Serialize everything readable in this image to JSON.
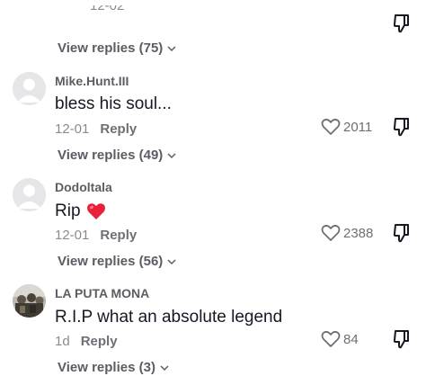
{
  "top": {
    "partial_timestamp": "12-02",
    "view_replies": "View replies (75)"
  },
  "comments": [
    {
      "username": "Mike.Hunt.III",
      "text": "bless his soul...",
      "date": "12-01",
      "reply_label": "Reply",
      "likes": "2011",
      "view_replies": "View replies (49)",
      "avatar": "default-avatar-icon"
    },
    {
      "username": "Dodoltala",
      "text": "Rip",
      "emoji": "red-heart-emoji",
      "date": "12-01",
      "reply_label": "Reply",
      "likes": "2388",
      "view_replies": "View replies (56)",
      "avatar": "default-avatar-icon"
    },
    {
      "username": "LA PUTA MONA",
      "text": "R.I.P what an absolute legend",
      "date": "1d",
      "reply_label": "Reply",
      "likes": "84",
      "view_replies": "View replies (3)",
      "avatar": "photo-avatar"
    }
  ],
  "colors": {
    "text_primary": "#161823",
    "text_secondary": "#8a8b91",
    "heart_emoji": "#e8203a"
  }
}
